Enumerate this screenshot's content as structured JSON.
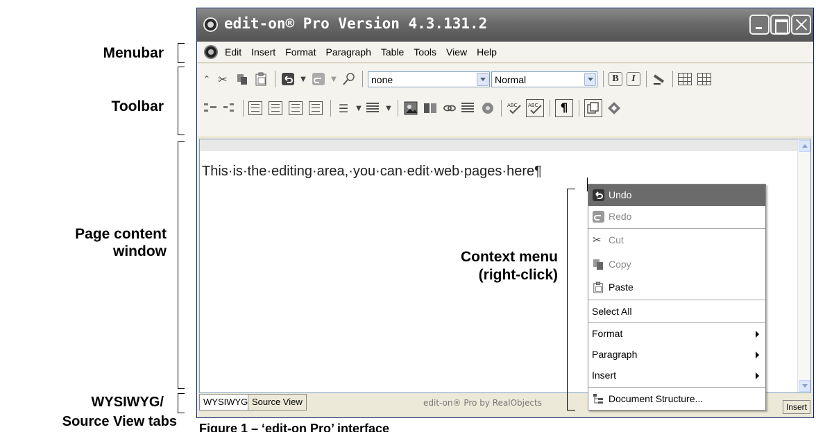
{
  "annotations": {
    "menubar": "Menubar",
    "toolbar": "Toolbar",
    "page_content_line1": "Page content",
    "page_content_line2": "window",
    "tabs_line1": "WYSIWYG/",
    "tabs_line2": "Source View tabs",
    "context_line1": "Context menu",
    "context_line2": "(right-click)"
  },
  "window": {
    "title": "edit-on® Pro Version 4.3.131.2"
  },
  "menubar": {
    "items": [
      "Edit",
      "Insert",
      "Format",
      "Paragraph",
      "Table",
      "Tools",
      "View",
      "Help"
    ]
  },
  "toolbar": {
    "style_select": "none",
    "paragraph_select": "Normal",
    "bold_label": "B",
    "italic_label": "I",
    "pilcrow_label": "¶"
  },
  "editor": {
    "text": "This·is·the·editing·area,·you·can·edit·web·pages·here¶"
  },
  "bottom": {
    "tab_wysiwyg": "WYSIWYG",
    "tab_source": "Source View",
    "credit": "edit-on® Pro by RealObjects",
    "mode": "Insert"
  },
  "context_menu": {
    "undo": "Undo",
    "redo": "Redo",
    "cut": "Cut",
    "copy": "Copy",
    "paste": "Paste",
    "select_all": "Select All",
    "format": "Format",
    "paragraph": "Paragraph",
    "insert": "Insert",
    "document_structure": "Document Structure..."
  },
  "caption": "Figure 1 – ‘edit-on Pro’ interface"
}
